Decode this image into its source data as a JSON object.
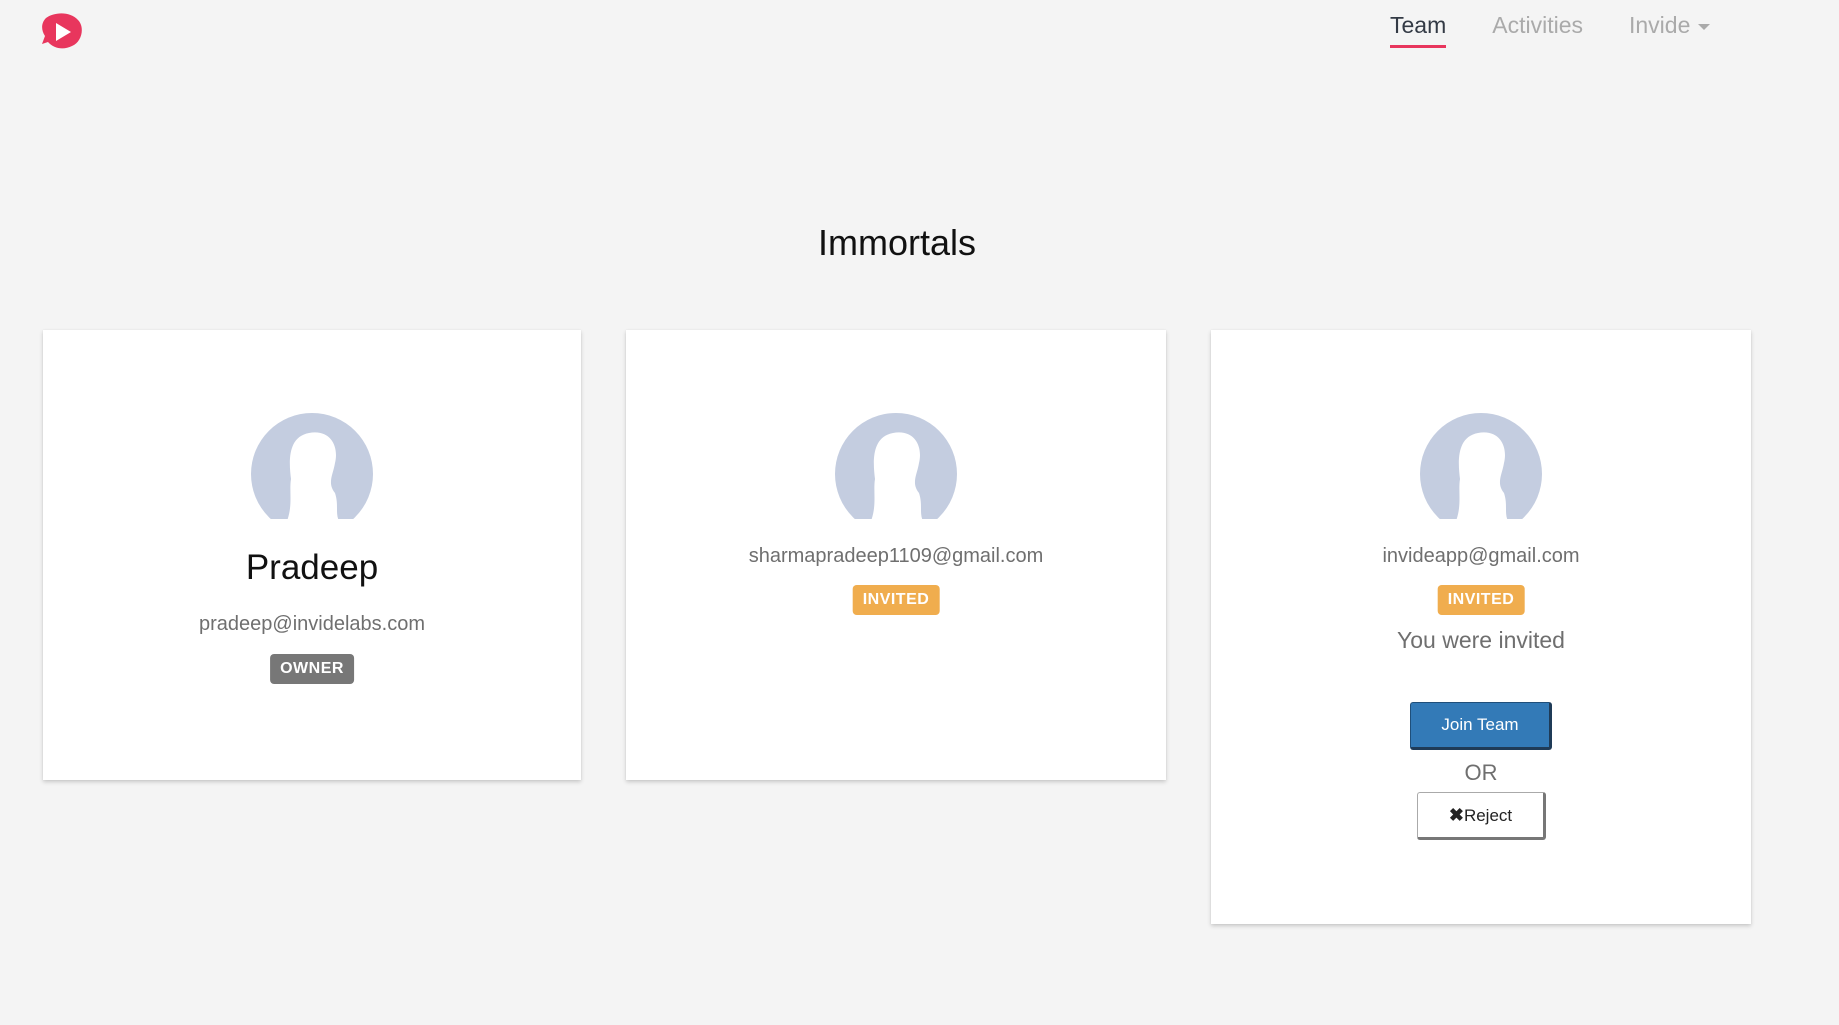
{
  "nav": {
    "logo_icon": "play-blob-logo",
    "items": [
      {
        "label": "Team",
        "active": true
      },
      {
        "label": "Activities",
        "active": false
      },
      {
        "label": "Invide",
        "active": false,
        "has_dropdown": true
      }
    ]
  },
  "team": {
    "name": "Immortals"
  },
  "members": [
    {
      "name": "Pradeep",
      "email": "pradeep@invidelabs.com",
      "badge": "OWNER"
    },
    {
      "email": "sharmapradeep1109@gmail.com",
      "badge": "INVITED"
    },
    {
      "email": "invideapp@gmail.com",
      "badge": "INVITED",
      "message": "You were invited",
      "join_label": "Join Team",
      "or_label": "OR",
      "reject_icon": "✖",
      "reject_label": "Reject"
    }
  ],
  "colors": {
    "accent": "#e8365d",
    "owner_badge": "#777777",
    "invited_badge": "#f0ad4e",
    "primary_button": "#337ab7",
    "avatar": "#c4cde0"
  }
}
